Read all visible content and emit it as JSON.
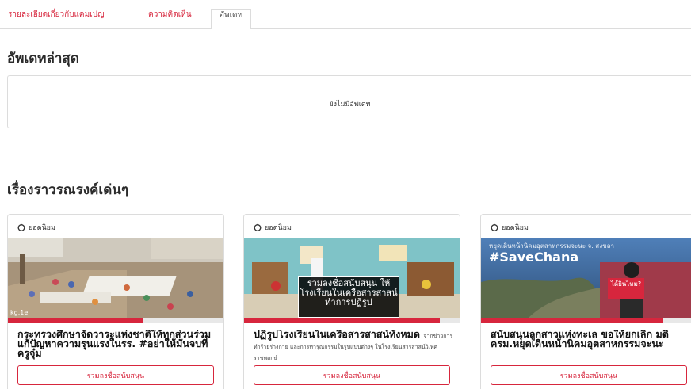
{
  "tabs": [
    {
      "label": "รายละเอียดเกี่ยวกับแคมเปญ",
      "active": false
    },
    {
      "label": "ความคิดเห็น",
      "active": false
    },
    {
      "label": "อัพเดท",
      "active": true
    }
  ],
  "latest_updates": {
    "title": "อัพเดทล่าสุด",
    "empty_text": "ยังไม่มีอัพเดท"
  },
  "featured": {
    "title": "เรื่องราวรณรงค์เด่นๆ",
    "cards": [
      {
        "badge": "ยอดนิยม",
        "image_watermark": "kg.1e",
        "title": "กระทรวงศึกษาจัดวาระแห่งชาติให้ทุกส่วนร่วมแก้ปัญหาความรุนแรงในรร. #อย่าให้มันจบที่ครูจุ๋ม",
        "description": "",
        "progress": 0.62,
        "cta": "ร่วมลงชื่อสนับสนุน"
      },
      {
        "badge": "ยอดนิยม",
        "image_overlay": "ร่วมลงชื่อสนับสนุน ให้โรงเรียนในเครือสารสาสน์ทำการปฏิรูป",
        "title": "ปฏิรูปโรงเรียนในเครือสารสาสน์ทั้งหมด",
        "description": "จากข่าวการทำร้ายร่างกาย และการทารุณกรรมในรูปแบบต่างๆ ในโรงเรียนสารสาสน์วิเทศราชพฤกษ์",
        "progress": 0.9,
        "cta": "ร่วมลงชื่อสนับสนุน"
      },
      {
        "badge": "ยอดนิยม",
        "image_topline": "หยุดเดินหน้านิคมอุตสาหกรรมจะนะ จ. สงขลา",
        "image_hashtag": "#SaveChana",
        "image_sign": "ได้ยินไหม?",
        "title": "สนับสนุนลูกสาวแห่งทะเล ขอให้ยกเลิก มติ ครม.หยุดเดินหน้านิคมอุตสาหกรรมจะนะ",
        "description": "",
        "progress": 0.84,
        "cta": "ร่วมลงชื่อสนับสนุน"
      }
    ]
  },
  "colors": {
    "accent": "#d7263d",
    "border": "#dcdcdc",
    "text": "#222222"
  },
  "icons": {
    "badge": "fire-icon"
  }
}
